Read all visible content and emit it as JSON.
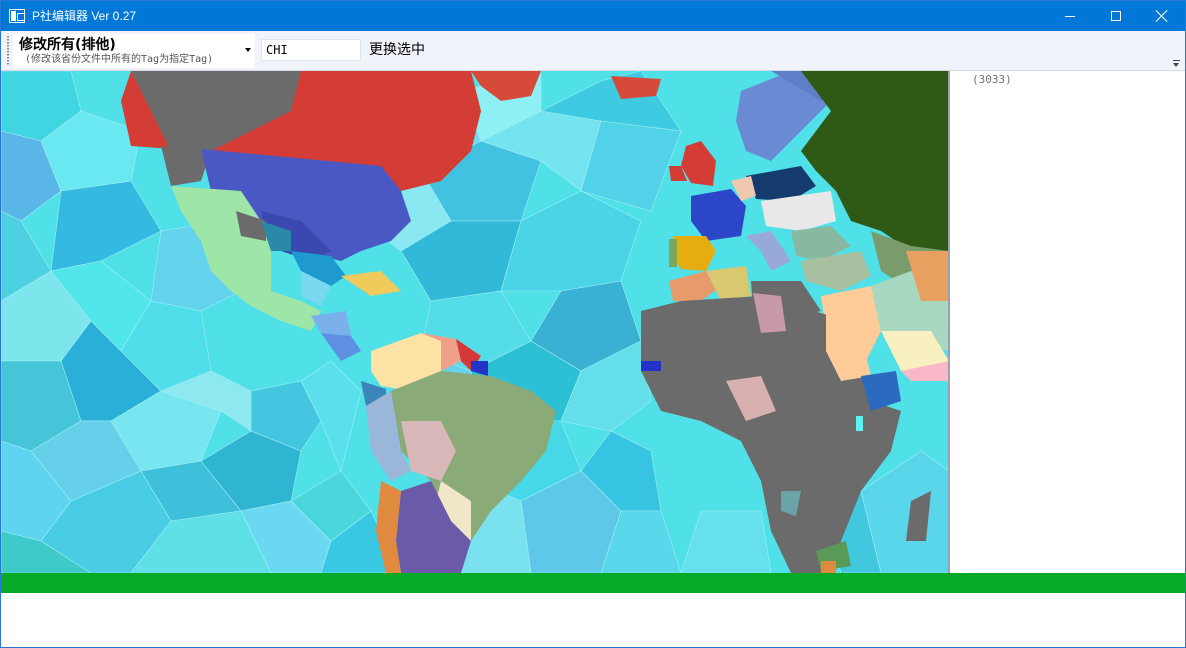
{
  "window": {
    "title": "P社编辑器 Ver 0.27"
  },
  "toolbar": {
    "mode_dropdown": {
      "selected_label": "修改所有(排他)",
      "description": "(修改该省份文件中所有的Tag为指定Tag)"
    },
    "tag_input_value": "CHI",
    "replace_button_label": "更换选中"
  },
  "side_panel": {
    "count_text": "(3033)"
  },
  "colors": {
    "titlebar": "#0078d7",
    "status_bar": "#06aa26",
    "ocean_base": "#4fe0e8",
    "unowned_grey": "#6b6b6b"
  },
  "icons": {
    "app": "app-window-icon",
    "minimize": "minimize-icon",
    "maximize": "maximize-icon",
    "close": "close-icon",
    "dropdown": "chevron-down-icon",
    "toolbar_overflow": "toolbar-overflow-icon"
  }
}
